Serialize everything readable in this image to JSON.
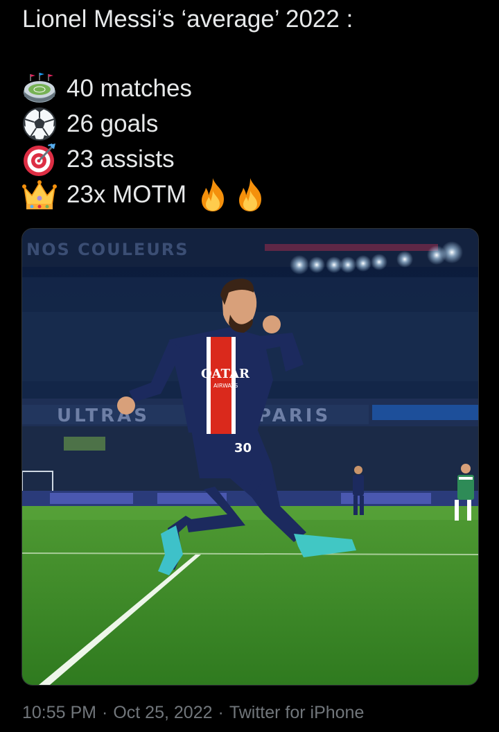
{
  "tweet": {
    "title": "Lionel Messi‘s ‘average’ 2022 :",
    "stats": [
      {
        "icon": "stadium-icon",
        "text": "40 matches"
      },
      {
        "icon": "soccer-ball-icon",
        "text": "26 goals"
      },
      {
        "icon": "target-icon",
        "text": "23 assists"
      },
      {
        "icon": "crown-icon",
        "text": "23x MOTM"
      }
    ],
    "trailing_icons": [
      "fire-icon",
      "fire-icon"
    ]
  },
  "media": {
    "banner_text": "NOS COULEURS",
    "stand_text_left": "ULTRAS",
    "stand_text_right": "PARIS",
    "sponsor_text": "QATAR",
    "sponsor_subtext": "AIRWAYS",
    "shirt_number": "30"
  },
  "meta": {
    "time": "10:55 PM",
    "date": "Oct 25, 2022",
    "source": "Twitter for iPhone"
  },
  "colors": {
    "background": "#000000",
    "text": "#e7e9ea",
    "muted": "#71767b",
    "psg_navy": "#1c2a5e",
    "pitch": "#3f8f2a"
  }
}
